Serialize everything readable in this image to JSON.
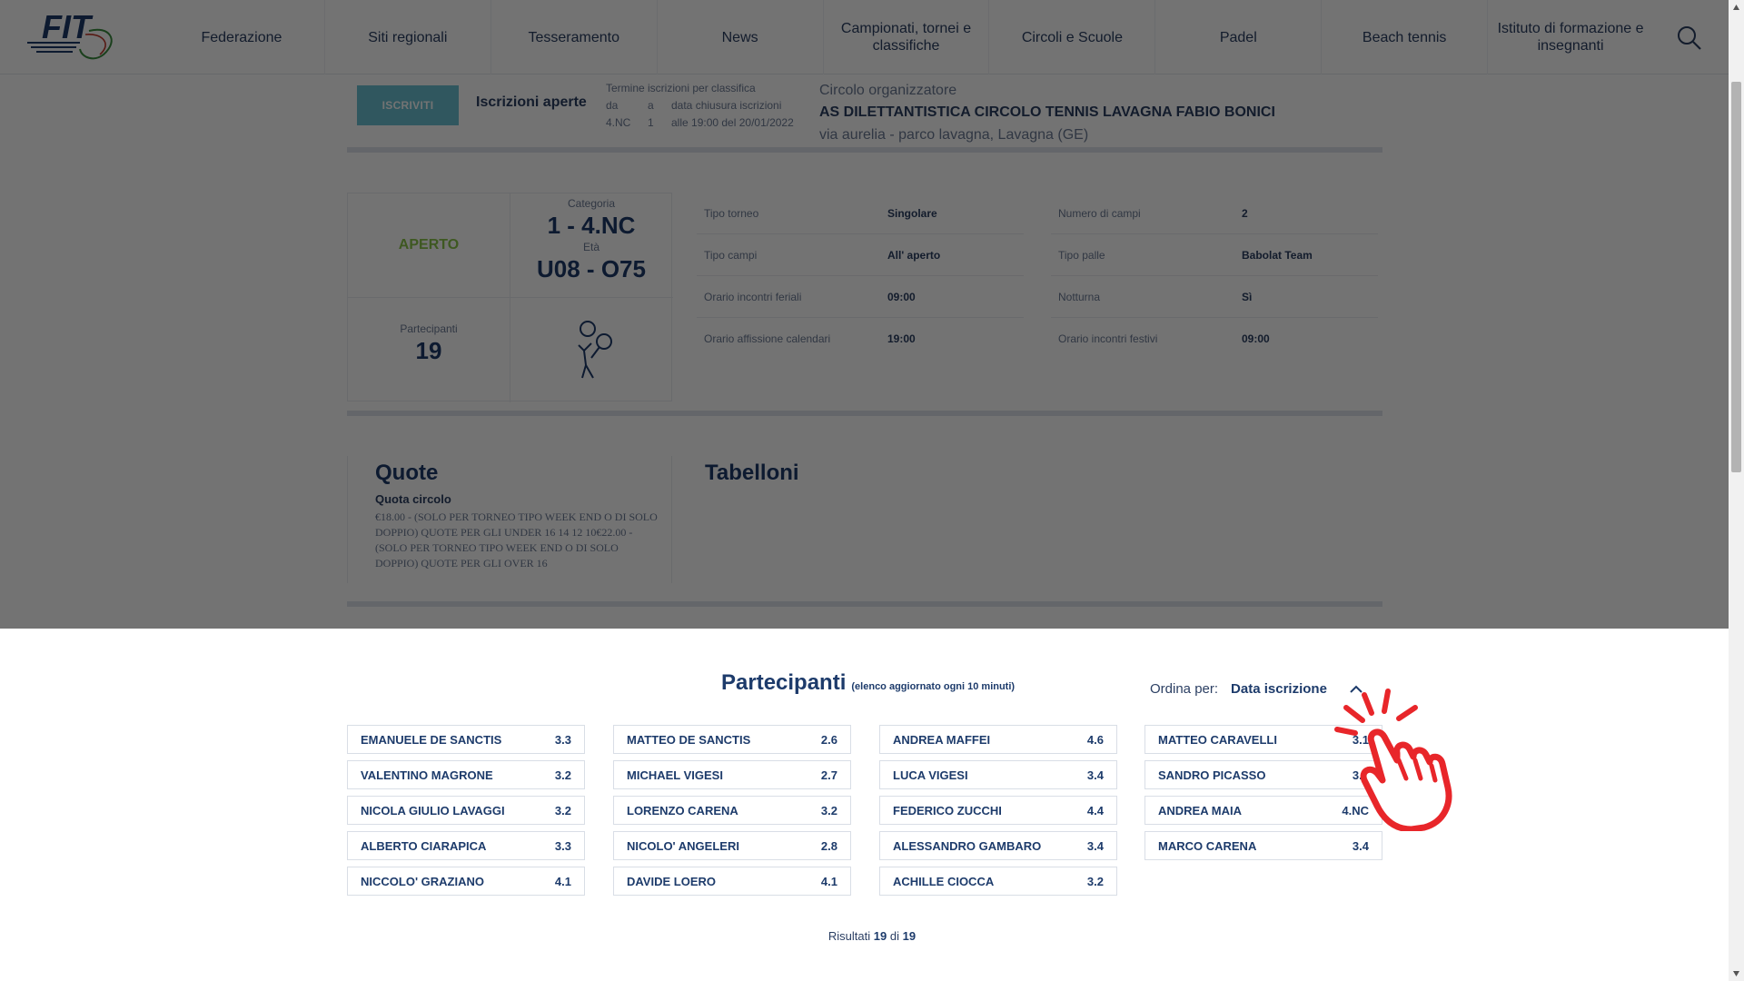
{
  "header": {
    "logo_text": "FIT",
    "nav": [
      "Federazione",
      "Siti regionali",
      "Tesseramento",
      "News",
      "Campionati, tornei e classifiche",
      "Circoli e Scuole",
      "Padel",
      "Beach tennis",
      "Istituto di formazione e insegnanti"
    ],
    "search_icon": "search-icon"
  },
  "registration": {
    "button_label": "ISCRIVITI",
    "status": "Iscrizioni aperte",
    "termine_title": "Termine iscrizioni per classifica",
    "da_label": "da",
    "a_label": "a",
    "data_label": "data chiusura iscrizioni",
    "da_value": "4.NC",
    "a_value": "1",
    "data_value": "alle 19:00 del 20/01/2022",
    "org_label": "Circolo organizzatore",
    "org_name": "AS DILETTANTISTICA CIRCOLO TENNIS LAVAGNA FABIO BONICI",
    "org_address": "via aurelia - parco lavagna, Lavagna (GE)"
  },
  "stats": {
    "status": "APERTO",
    "categoria_label": "Categoria",
    "categoria_value": "1 - 4.NC",
    "eta_label": "Età",
    "eta_value": "U08 - O75",
    "partecipanti_label": "Partecipanti",
    "partecipanti_value": "19",
    "player_icon": "tennis-player-icon"
  },
  "details_left": [
    {
      "k": "Tipo torneo",
      "v": "Singolare"
    },
    {
      "k": "Tipo campi",
      "v": "All' aperto"
    },
    {
      "k": "Orario incontri feriali",
      "v": "09:00"
    },
    {
      "k": "Orario affissione calendari",
      "v": "19:00"
    }
  ],
  "details_right": [
    {
      "k": "Numero di campi",
      "v": "2"
    },
    {
      "k": "Tipo palle",
      "v": "Babolat Team"
    },
    {
      "k": "Notturna",
      "v": "Sì"
    },
    {
      "k": "Orario incontri festivi",
      "v": "09:00"
    }
  ],
  "quote": {
    "title": "Quote",
    "subtitle": "Quota circolo",
    "text": "€18.00 - (SOLO PER TORNEO TIPO WEEK END O DI SOLO DOPPIO) QUOTE PER GLI UNDER 16 14 12 10€22.00 - (SOLO PER TORNEO TIPO WEEK END O DI SOLO DOPPIO) QUOTE PER GLI OVER 16",
    "tabelloni_title": "Tabelloni"
  },
  "participants": {
    "title": "Partecipanti",
    "note": "(elenco aggiornato ogni 10 minuti)",
    "sort_label": "Ordina per:",
    "sort_value": "Data iscrizione",
    "columns": [
      [
        {
          "name": "EMANUELE DE SANCTIS",
          "rank": "3.3"
        },
        {
          "name": "VALENTINO MAGRONE",
          "rank": "3.2"
        },
        {
          "name": "NICOLA GIULIO LAVAGGI",
          "rank": "3.2"
        },
        {
          "name": "ALBERTO CIARAPICA",
          "rank": "3.3"
        },
        {
          "name": "NICCOLO' GRAZIANO",
          "rank": "4.1"
        }
      ],
      [
        {
          "name": "MATTEO DE SANCTIS",
          "rank": "2.6"
        },
        {
          "name": "MICHAEL VIGESI",
          "rank": "2.7"
        },
        {
          "name": "LORENZO CARENA",
          "rank": "3.2"
        },
        {
          "name": "NICOLO' ANGELERI",
          "rank": "2.8"
        },
        {
          "name": "DAVIDE LOERO",
          "rank": "4.1"
        }
      ],
      [
        {
          "name": "ANDREA MAFFEI",
          "rank": "4.6"
        },
        {
          "name": "LUCA VIGESI",
          "rank": "3.4"
        },
        {
          "name": "FEDERICO ZUCCHI",
          "rank": "4.4"
        },
        {
          "name": "ALESSANDRO GAMBARO",
          "rank": "3.4"
        },
        {
          "name": "ACHILLE CIOCCA",
          "rank": "3.2"
        }
      ],
      [
        {
          "name": "MATTEO CARAVELLI",
          "rank": "3.1"
        },
        {
          "name": "SANDRO PICASSO",
          "rank": "3.5"
        },
        {
          "name": "ANDREA MAIA",
          "rank": "4.NC"
        },
        {
          "name": "MARCO CARENA",
          "rank": "3.4"
        }
      ]
    ],
    "results_prefix": "Risultati",
    "results_shown": "19",
    "results_of": "di",
    "results_total": "19"
  },
  "colors": {
    "accent": "#6ac2d2",
    "navy": "#1d3b6b",
    "open_green": "#8bc34a",
    "pointer_red": "#e8262a"
  }
}
